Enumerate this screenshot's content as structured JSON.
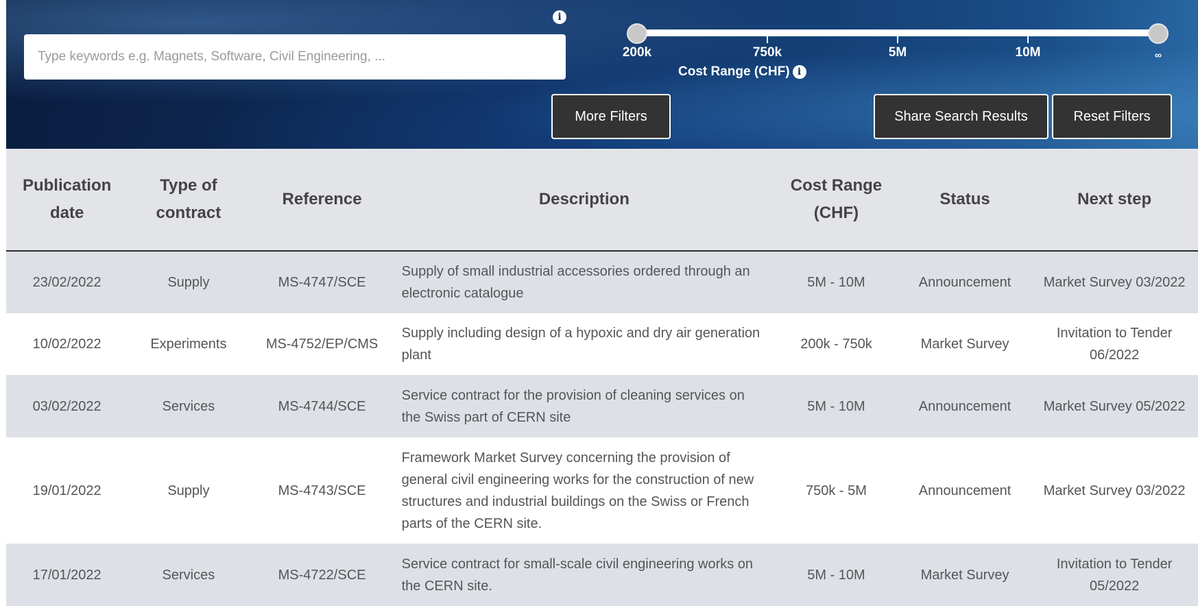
{
  "search": {
    "placeholder": "Type keywords e.g. Magnets, Software, Civil Engineering, ...",
    "info_icon": "i"
  },
  "cost_range": {
    "caption": "Cost Range (CHF)",
    "info_icon": "i",
    "ticks": [
      "200k",
      "750k",
      "5M",
      "10M",
      "∞"
    ],
    "selected_min": "200k",
    "selected_max": "∞"
  },
  "buttons": {
    "more_filters": "More Filters",
    "share": "Share Search Results",
    "reset": "Reset Filters"
  },
  "table": {
    "headers": [
      "Publication date",
      "Type of contract",
      "Reference",
      "Description",
      "Cost Range (CHF)",
      "Status",
      "Next step"
    ],
    "rows": [
      {
        "date": "23/02/2022",
        "type": "Supply",
        "reference": "MS-4747/SCE",
        "description": "Supply of small industrial accessories ordered through an electronic catalogue",
        "cost": "5M - 10M",
        "status": "Announcement",
        "next": "Market Survey 03/2022"
      },
      {
        "date": "10/02/2022",
        "type": "Experiments",
        "reference": "MS-4752/EP/CMS",
        "description": "Supply including design of a hypoxic and dry air generation plant",
        "cost": "200k - 750k",
        "status": "Market Survey",
        "next": "Invitation to Tender 06/2022"
      },
      {
        "date": "03/02/2022",
        "type": "Services",
        "reference": "MS-4744/SCE",
        "description": "Service contract for the provision of cleaning services on the Swiss part of CERN site",
        "cost": "5M - 10M",
        "status": "Announcement",
        "next": "Market Survey 05/2022"
      },
      {
        "date": "19/01/2022",
        "type": "Supply",
        "reference": "MS-4743/SCE",
        "description": "Framework Market Survey concerning the provision of general civil engineering works for the construction of new structures and industrial buildings on the Swiss or French parts of the CERN site.",
        "cost": "750k - 5M",
        "status": "Announcement",
        "next": "Market Survey 03/2022"
      },
      {
        "date": "17/01/2022",
        "type": "Services",
        "reference": "MS-4722/SCE",
        "description": "Service contract for small-scale civil engineering works on the CERN site.",
        "cost": "5M - 10M",
        "status": "Market Survey",
        "next": "Invitation to Tender 05/2022"
      }
    ]
  },
  "colors": {
    "banner_dark": "#0f2c5a",
    "button_bg": "#333333",
    "row_shaded": "#dde0e6",
    "header_bg": "#e3e4e8"
  }
}
